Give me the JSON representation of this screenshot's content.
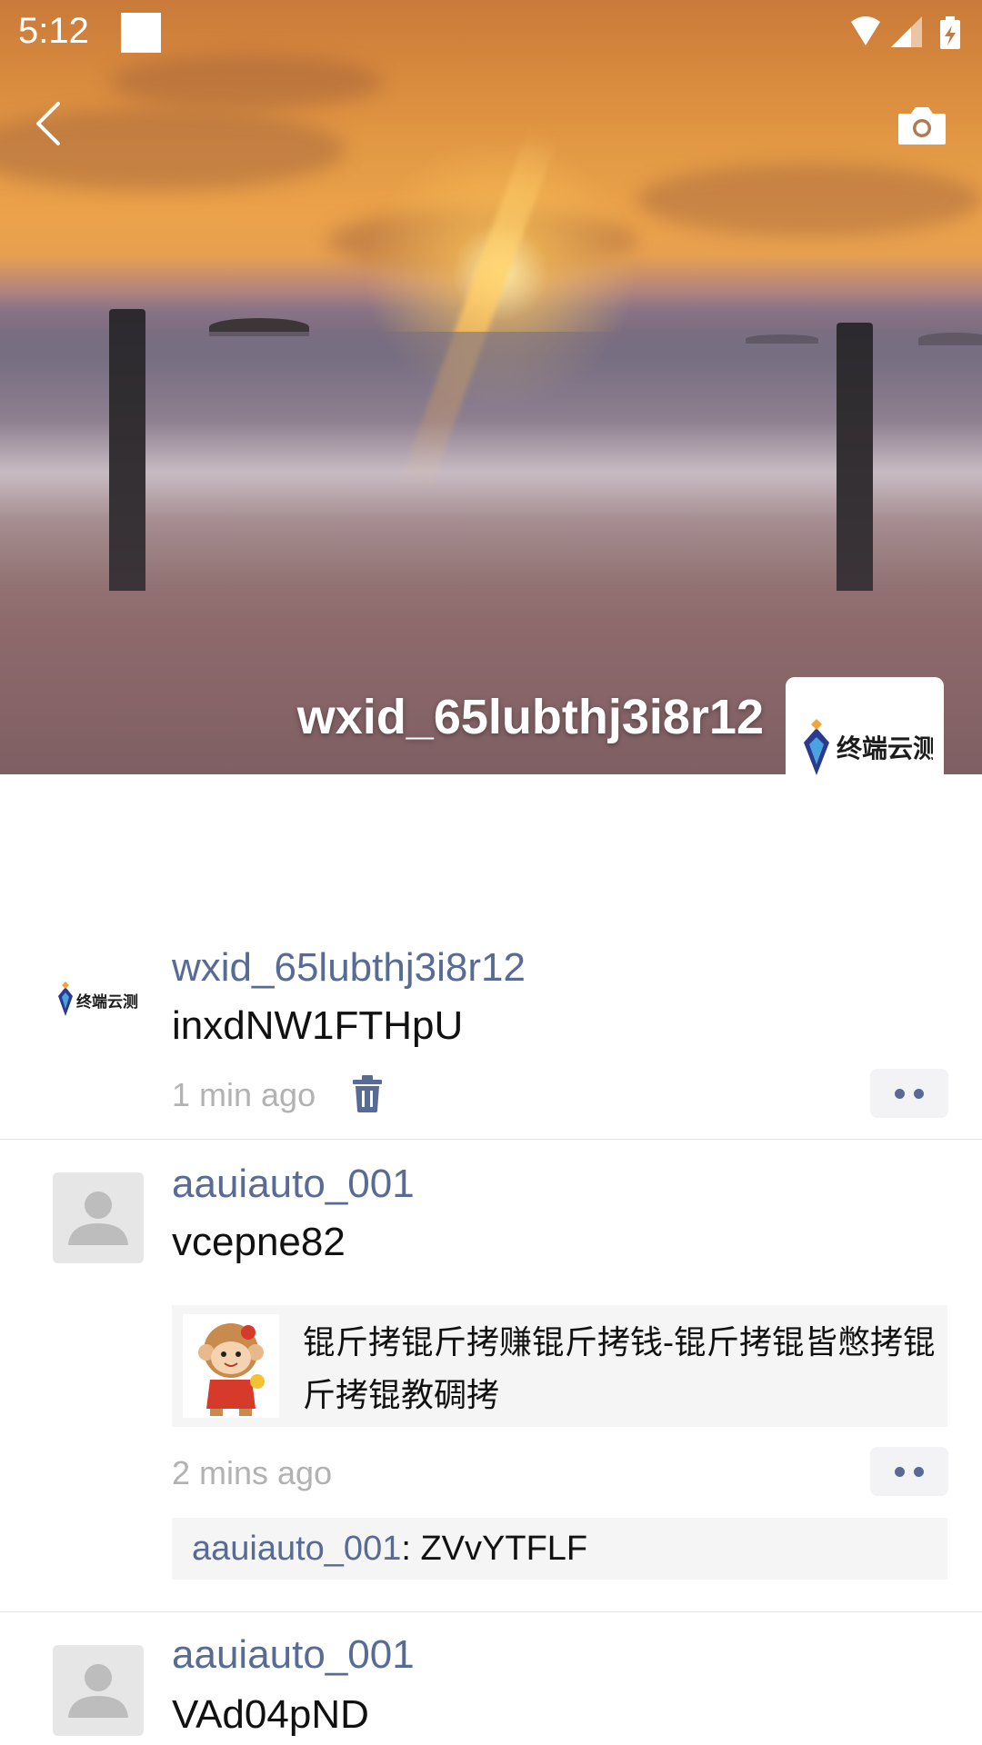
{
  "status_bar": {
    "time": "5:12"
  },
  "header": {
    "back_icon": "chevron-left-icon",
    "camera_icon": "camera-icon",
    "profile_name": "wxid_65lubthj3i8r12",
    "profile_avatar_logo": "终端云测"
  },
  "posts": [
    {
      "author": "wxid_65lubthj3i8r12",
      "content": "inxdNW1FTHpU",
      "time": "1 min ago",
      "avatar_logo": "终端云测"
    },
    {
      "author": "aauiauto_001",
      "content": "vcepne82",
      "link_text": "锟斤拷锟斤拷赚锟斤拷钱-锟斤拷锟皆憋拷锟斤拷锟教碉拷",
      "time": "2 mins ago",
      "comment_author": "aauiauto_001",
      "comment_separator": ": ",
      "comment_text": "ZVvYTFLF"
    },
    {
      "author": "aauiauto_001",
      "content": "VAd04pND"
    }
  ],
  "colors": {
    "link_blue": "#576b95",
    "time_gray": "#b2b2b2"
  }
}
